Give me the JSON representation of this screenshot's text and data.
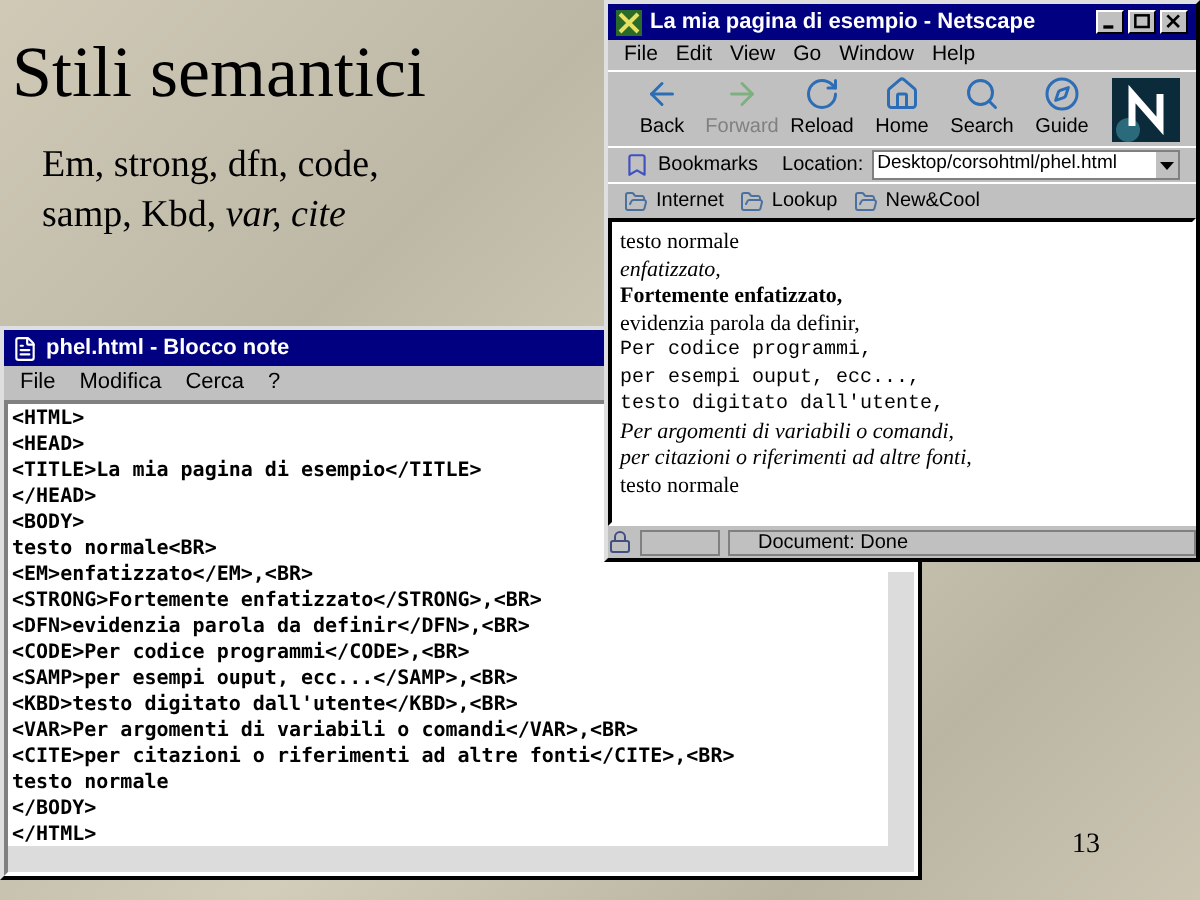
{
  "slide": {
    "title": "Stili semantici",
    "subtitle": "Em, strong, dfn, code, samp, Kbd, *var, cite*",
    "page_number": "13"
  },
  "notepad": {
    "title": "phel.html - Blocco note",
    "menu": [
      "File",
      "Modifica",
      "Cerca",
      "?"
    ],
    "lines": [
      "<HTML>",
      "<HEAD>",
      "<TITLE>La mia pagina di esempio</TITLE>",
      "</HEAD>",
      "<BODY>",
      "testo normale<BR>",
      "<EM>enfatizzato</EM>,<BR>",
      "<STRONG>Fortemente enfatizzato</STRONG>,<BR>",
      "<DFN>evidenzia parola da definir</DFN>,<BR>",
      "<CODE>Per codice programmi</CODE>,<BR>",
      "<SAMP>per esempi ouput, ecc...</SAMP>,<BR>",
      "<KBD>testo digitato dall'utente</KBD>,<BR>",
      "<VAR>Per argomenti di variabili o comandi</VAR>,<BR>",
      "<CITE>per citazioni o riferimenti ad altre fonti</CITE>,<BR>",
      "testo normale",
      "</BODY>",
      "</HTML>"
    ]
  },
  "browser": {
    "title": "La mia pagina di esempio - Netscape",
    "menu": [
      "File",
      "Edit",
      "View",
      "Go",
      "Window",
      "Help"
    ],
    "toolbar": [
      {
        "label": "Back",
        "kind": "back",
        "disabled": false
      },
      {
        "label": "Forward",
        "kind": "forward",
        "disabled": true
      },
      {
        "label": "Reload",
        "kind": "reload",
        "disabled": false
      },
      {
        "label": "Home",
        "kind": "home",
        "disabled": false
      },
      {
        "label": "Search",
        "kind": "search",
        "disabled": false
      },
      {
        "label": "Guide",
        "kind": "guide",
        "disabled": false
      }
    ],
    "bookmarks": "Bookmarks",
    "location_label": "Location:",
    "location": "Desktop/corsohtml/phel.html",
    "personal_toolbar": [
      "Internet",
      "Lookup",
      "New&Cool"
    ],
    "content": [
      {
        "text": "testo normale",
        "kind": "normal"
      },
      {
        "text": "enfatizzato,",
        "kind": "em"
      },
      {
        "text": "Fortemente enfatizzato,",
        "kind": "strong"
      },
      {
        "text": "evidenzia parola da definir,",
        "kind": "dfn"
      },
      {
        "text": "Per codice programmi,",
        "kind": "code"
      },
      {
        "text": "per esempi ouput, ecc...,",
        "kind": "samp"
      },
      {
        "text": "testo digitato dall'utente,",
        "kind": "kbd"
      },
      {
        "text": "Per argomenti di variabili o comandi,",
        "kind": "var"
      },
      {
        "text": "per citazioni o riferimenti ad altre fonti,",
        "kind": "cite"
      },
      {
        "text": "testo normale",
        "kind": "normal"
      }
    ],
    "status": "Document: Done"
  }
}
